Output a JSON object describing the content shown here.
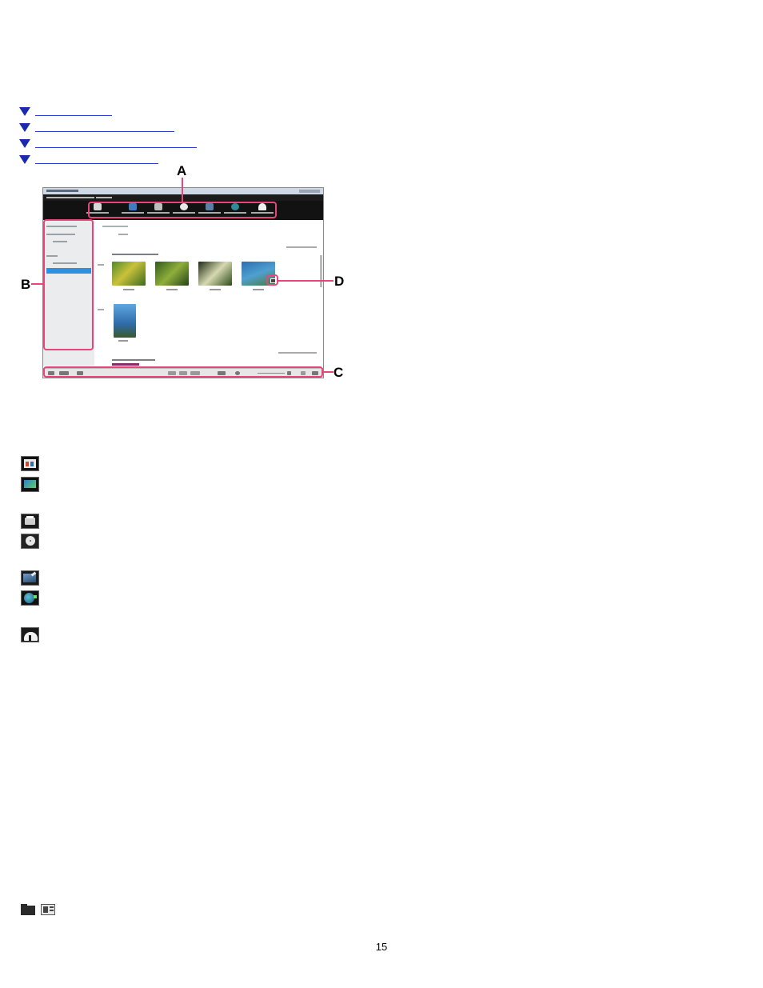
{
  "callouts": {
    "a": "A",
    "b": "B",
    "c": "C",
    "d": "D"
  },
  "icons": {
    "index": "calendar-index-icon",
    "slideshow": "slideshow-icon",
    "print": "printer-icon",
    "disc": "disc-icon",
    "edit": "edit-icon",
    "share": "globe-share-icon",
    "cloud": "cloud-upload-icon",
    "folder": "folder-icon",
    "view": "view-mode-icon"
  },
  "colors": {
    "callout": "#e8457a",
    "link": "#1a2aa8",
    "toolbar": "#121212"
  },
  "page_number": "15"
}
